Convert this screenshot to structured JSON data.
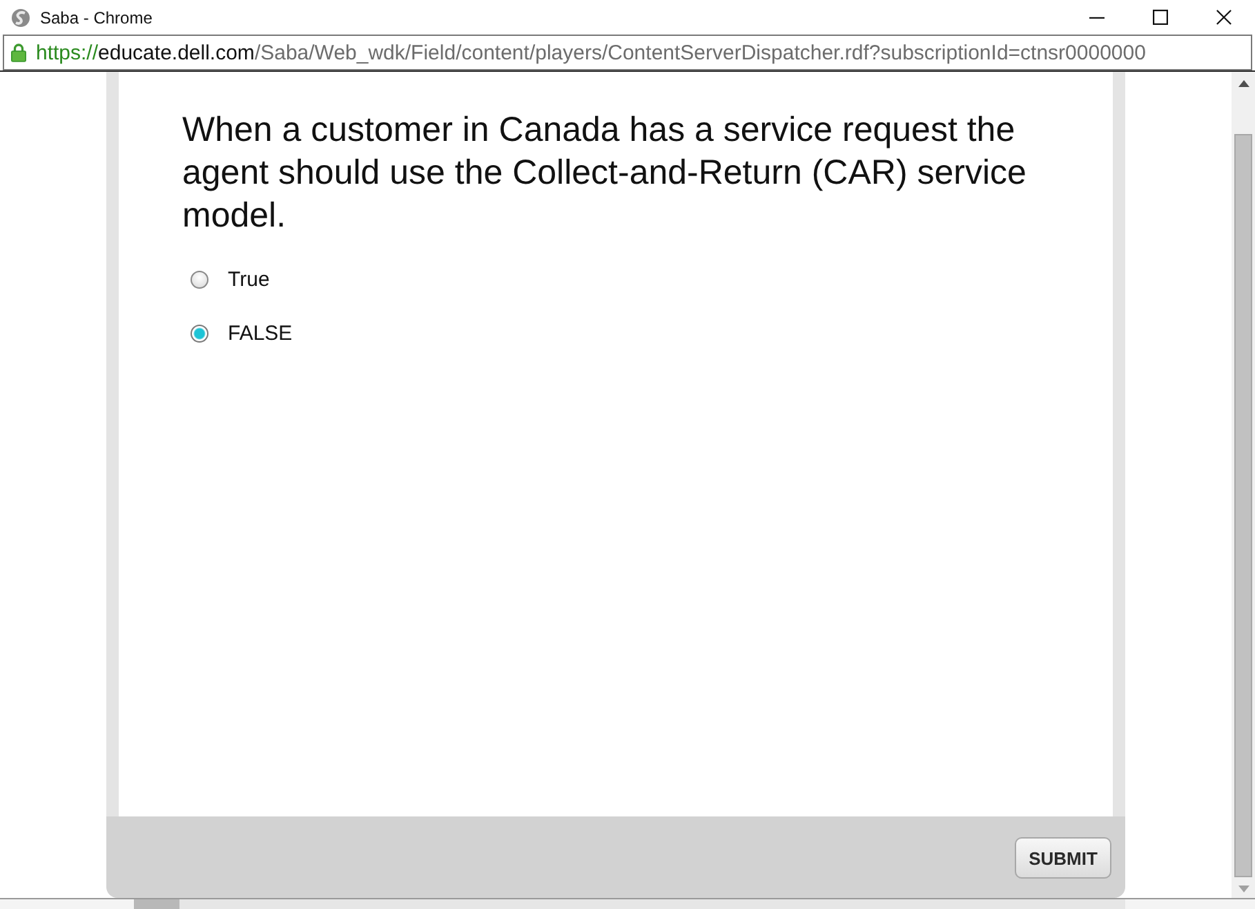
{
  "window": {
    "title": "Saba - Chrome"
  },
  "address_bar": {
    "url": {
      "scheme": "https://",
      "host": "educate.dell.com",
      "path": "/Saba/Web_wdk/Field/content/players/ContentServerDispatcher.rdf?subscriptionId=ctnsr0000000"
    }
  },
  "question": {
    "text": "When a customer in Canada has a service request the agent should use the Collect-and-Return (CAR) service model.",
    "options": [
      {
        "label": "True",
        "selected": false
      },
      {
        "label": "FALSE",
        "selected": true
      }
    ]
  },
  "submit_button": {
    "label": "SUBMIT"
  }
}
